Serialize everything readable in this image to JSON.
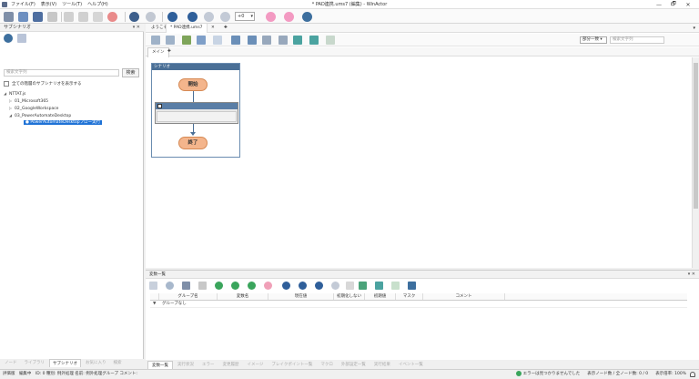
{
  "window": {
    "title": "* PAD連携.ums7 (編集) - WinActor",
    "menu": [
      "ファイル(F)",
      "表示(V)",
      "ツール(T)",
      "ヘルプ(H)"
    ],
    "controls": [
      "—",
      "🗗",
      "✕"
    ]
  },
  "toolbar": {
    "speed_value": "+0"
  },
  "left_pane": {
    "title": "サブシナリオ",
    "controls": "▾ ✕",
    "search_placeholder": "検索文字列",
    "search_button": "検索",
    "show_all_label": "全ての階層のサブシナリオを表示する",
    "tree": [
      {
        "label": "NTTAT.js",
        "level": 0,
        "toggle": "◢"
      },
      {
        "label": "01_Microsoft365",
        "level": 1,
        "toggle": "▷"
      },
      {
        "label": "02_GoogleWorkspace",
        "level": 1,
        "toggle": "▷"
      },
      {
        "label": "03_PowerAutomateDesktop",
        "level": 1,
        "toggle": "◢"
      },
      {
        "label": "PowerAutomateDesktopフロー実行",
        "level": 2,
        "toggle": "●",
        "selected": true
      }
    ],
    "tabs": [
      "ノード",
      "ライブラリ",
      "サブシナリオ",
      "お気に入り",
      "検索"
    ],
    "active_tab": 2
  },
  "editor": {
    "doc_tabs": [
      "ようこそ",
      "* PAD連携.ums7",
      "✕",
      "✚"
    ],
    "doc_menu": "▾",
    "filter_value": "部分一致 ▾",
    "filter_placeholder": "検索文字列",
    "sub_tabs": [
      "メイン",
      "✚"
    ],
    "scenario": {
      "header": "シナリオ",
      "start_label": "開始",
      "end_label": "終了"
    }
  },
  "variables": {
    "title": "変数一覧",
    "controls": "▾ ✕",
    "columns": [
      "",
      "グループ名",
      "変数名",
      "現在値",
      "初期化しない",
      "初期値",
      "マスク",
      "コメント"
    ],
    "rows": [
      {
        "toggle": "▼",
        "group": "グループなし"
      }
    ],
    "tabs": [
      "変数一覧",
      "実行状況",
      "エラー",
      "変更履歴",
      "イメージ",
      "ブレイクポイント一覧",
      "マクロ",
      "外部設定一覧",
      "実行結果",
      "イベント一覧"
    ],
    "active_tab": 0
  },
  "status": {
    "mode": "評価版",
    "edit_label": "編集中",
    "detail": "ID: 0 種別: 例外処理 名前: 例外処理グループ コメント:",
    "errors": "エラーは見つかりませんでした",
    "node_counts": "表示ノード数 / 全ノード数: 0 / 0",
    "zoom": "表示倍率: 100%"
  }
}
